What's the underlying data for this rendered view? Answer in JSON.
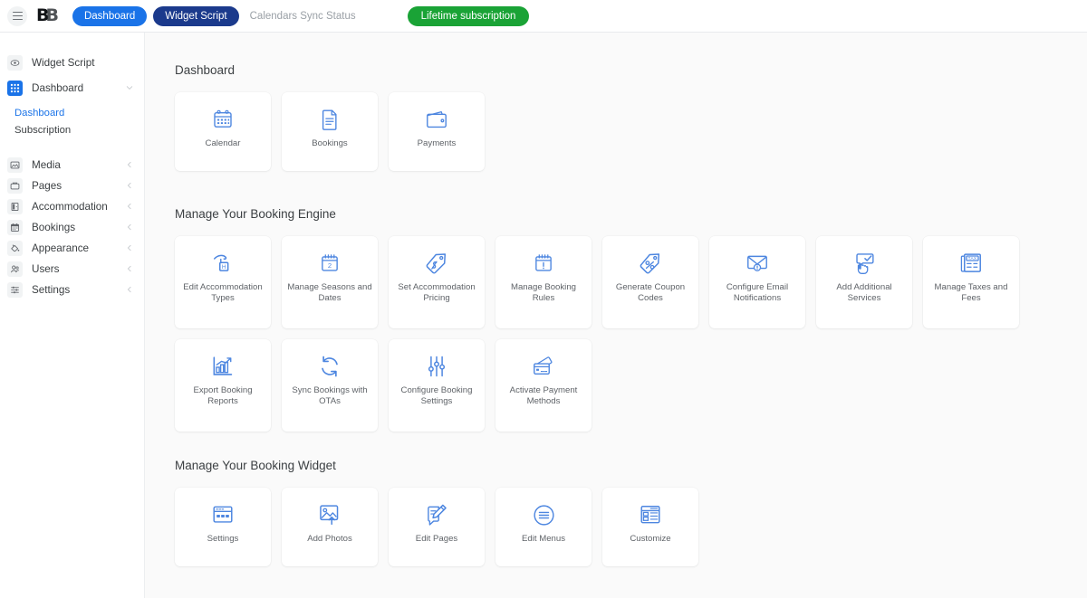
{
  "topbar": {
    "menu_icon": "hamburger-icon",
    "logo": "B",
    "logo_suffix": "B",
    "dashboard_pill": "Dashboard",
    "widget_pill": "Widget Script",
    "calendars_sync_status": "Calendars Sync Status",
    "subscription_pill": "Lifetime subscription",
    "colors": {
      "dashboard_pill": "#1a73e8",
      "widget_pill": "#1b3a8c",
      "subscription_pill": "#1aa336",
      "muted_text": "#9aa0a6"
    }
  },
  "sidebar": {
    "items": [
      {
        "label": "Widget Script",
        "icon": "eye-icon",
        "chevron": "",
        "active": false
      },
      {
        "label": "Dashboard",
        "icon": "grid-icon",
        "chevron": "v",
        "active": true
      },
      {
        "label": "Media",
        "icon": "image-icon",
        "chevron": "<",
        "active": false
      },
      {
        "label": "Pages",
        "icon": "folder-icon",
        "chevron": "<",
        "active": false
      },
      {
        "label": "Accommodation",
        "icon": "building-icon",
        "chevron": "<",
        "active": false
      },
      {
        "label": "Bookings",
        "icon": "calendar-icon",
        "chevron": "<",
        "active": false
      },
      {
        "label": "Appearance",
        "icon": "paint-bucket-icon",
        "chevron": "<",
        "active": false
      },
      {
        "label": "Users",
        "icon": "users-icon",
        "chevron": "<",
        "active": false
      },
      {
        "label": "Settings",
        "icon": "sliders-icon",
        "chevron": "<",
        "active": false
      }
    ],
    "sub_items": [
      {
        "label": "Dashboard",
        "selected": true
      },
      {
        "label": "Subscription",
        "selected": false
      }
    ],
    "accent_color": "#1a73e8"
  },
  "main": {
    "sections": [
      {
        "title": "Dashboard",
        "cards": [
          {
            "label": "Calendar",
            "icon": "calendar-icon"
          },
          {
            "label": "Bookings",
            "icon": "document-icon"
          },
          {
            "label": "Payments",
            "icon": "wallet-icon"
          }
        ]
      },
      {
        "title": "Manage Your Booking Engine",
        "cards": [
          {
            "label": "Edit Accommodation Types",
            "icon": "hotel-tag-icon"
          },
          {
            "label": "Manage Seasons and Dates",
            "icon": "calendar-two-icon"
          },
          {
            "label": "Set Accommodation Pricing",
            "icon": "price-tag-icon"
          },
          {
            "label": "Manage Booking Rules",
            "icon": "calendar-alert-icon"
          },
          {
            "label": "Generate Coupon Codes",
            "icon": "percent-tag-icon"
          },
          {
            "label": "Configure Email Notifications",
            "icon": "envelope-alert-icon"
          },
          {
            "label": "Add Additional Services",
            "icon": "click-check-icon"
          },
          {
            "label": "Manage Taxes and Fees",
            "icon": "tax-doc-icon"
          },
          {
            "label": "Export Booking Reports",
            "icon": "bar-chart-icon"
          },
          {
            "label": "Sync Bookings with OTAs",
            "icon": "sync-icon"
          },
          {
            "label": "Configure Booking Settings",
            "icon": "sliders-icon"
          },
          {
            "label": "Activate Payment Methods",
            "icon": "card-swipe-icon"
          }
        ]
      },
      {
        "title": "Manage Your Booking Widget",
        "cards": [
          {
            "label": "Settings",
            "icon": "window-settings-icon"
          },
          {
            "label": "Add Photos",
            "icon": "photo-upload-icon"
          },
          {
            "label": "Edit Pages",
            "icon": "page-pencil-icon"
          },
          {
            "label": "Edit Menus",
            "icon": "menu-circle-icon"
          },
          {
            "label": "Customize",
            "icon": "layout-customize-icon"
          }
        ]
      }
    ],
    "icon_color": "#4d86e0",
    "background": "#fafafa"
  }
}
